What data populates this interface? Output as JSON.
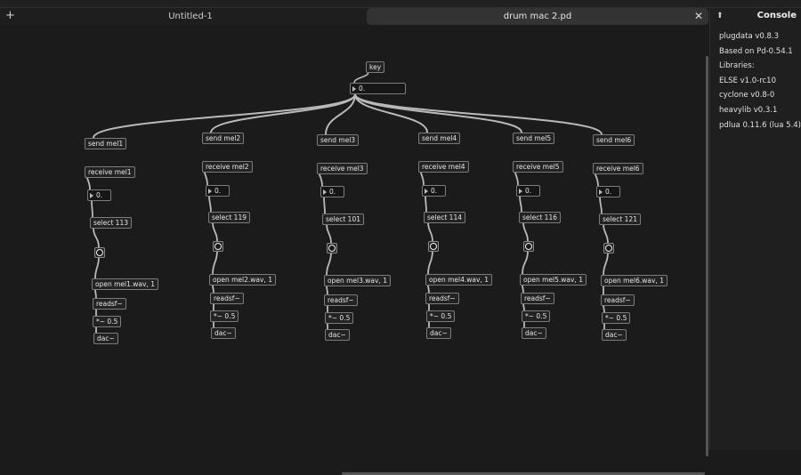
{
  "tabs": {
    "add_label": "+",
    "tab1": "Untitled-1",
    "tab2": "drum mac 2.pd",
    "close_glyph": "✕"
  },
  "console": {
    "title": "Console",
    "pin_glyph": "⬆",
    "lines": [
      "plugdata v0.8.3",
      "Based on Pd-0.54.1",
      "Libraries:",
      "ELSE v1.0-rc10",
      "cyclone v0.8-0",
      "heavylib v0.3.1",
      "pdlua 0.11.6 (lua 5.4)"
    ]
  },
  "patch": {
    "key": "key",
    "master_number": "0.",
    "columns": [
      {
        "send": "send mel1",
        "receive": "receive mel1",
        "number": "0.",
        "select": "select 113",
        "open": "open mel1.wav, 1",
        "readsf": "readsf~",
        "mult": "*~ 0.5",
        "dac": "dac~"
      },
      {
        "send": "send mel2",
        "receive": "receive mel2",
        "number": "0.",
        "select": "select 119",
        "open": "open mel2.wav, 1",
        "readsf": "readsf~",
        "mult": "*~ 0.5",
        "dac": "dac~"
      },
      {
        "send": "send mel3",
        "receive": "receive mel3",
        "number": "0.",
        "select": "select 101",
        "open": "open mel3.wav, 1",
        "readsf": "readsf~",
        "mult": "*~ 0.5",
        "dac": "dac~"
      },
      {
        "send": "send mel4",
        "receive": "receive mel4",
        "number": "0.",
        "select": "select 114",
        "open": "open mel4.wav, 1",
        "readsf": "readsf~",
        "mult": "*~ 0.5",
        "dac": "dac~"
      },
      {
        "send": "send mel5",
        "receive": "receive mel5",
        "number": "0.",
        "select": "select 116",
        "open": "open mel5.wav, 1",
        "readsf": "readsf~",
        "mult": "*~ 0.5",
        "dac": "dac~"
      },
      {
        "send": "send mel6",
        "receive": "receive mel6",
        "number": "0.",
        "select": "select 121",
        "open": "open mel6.wav, 1",
        "readsf": "readsf~",
        "mult": "*~ 0.5",
        "dac": "dac~"
      }
    ]
  }
}
